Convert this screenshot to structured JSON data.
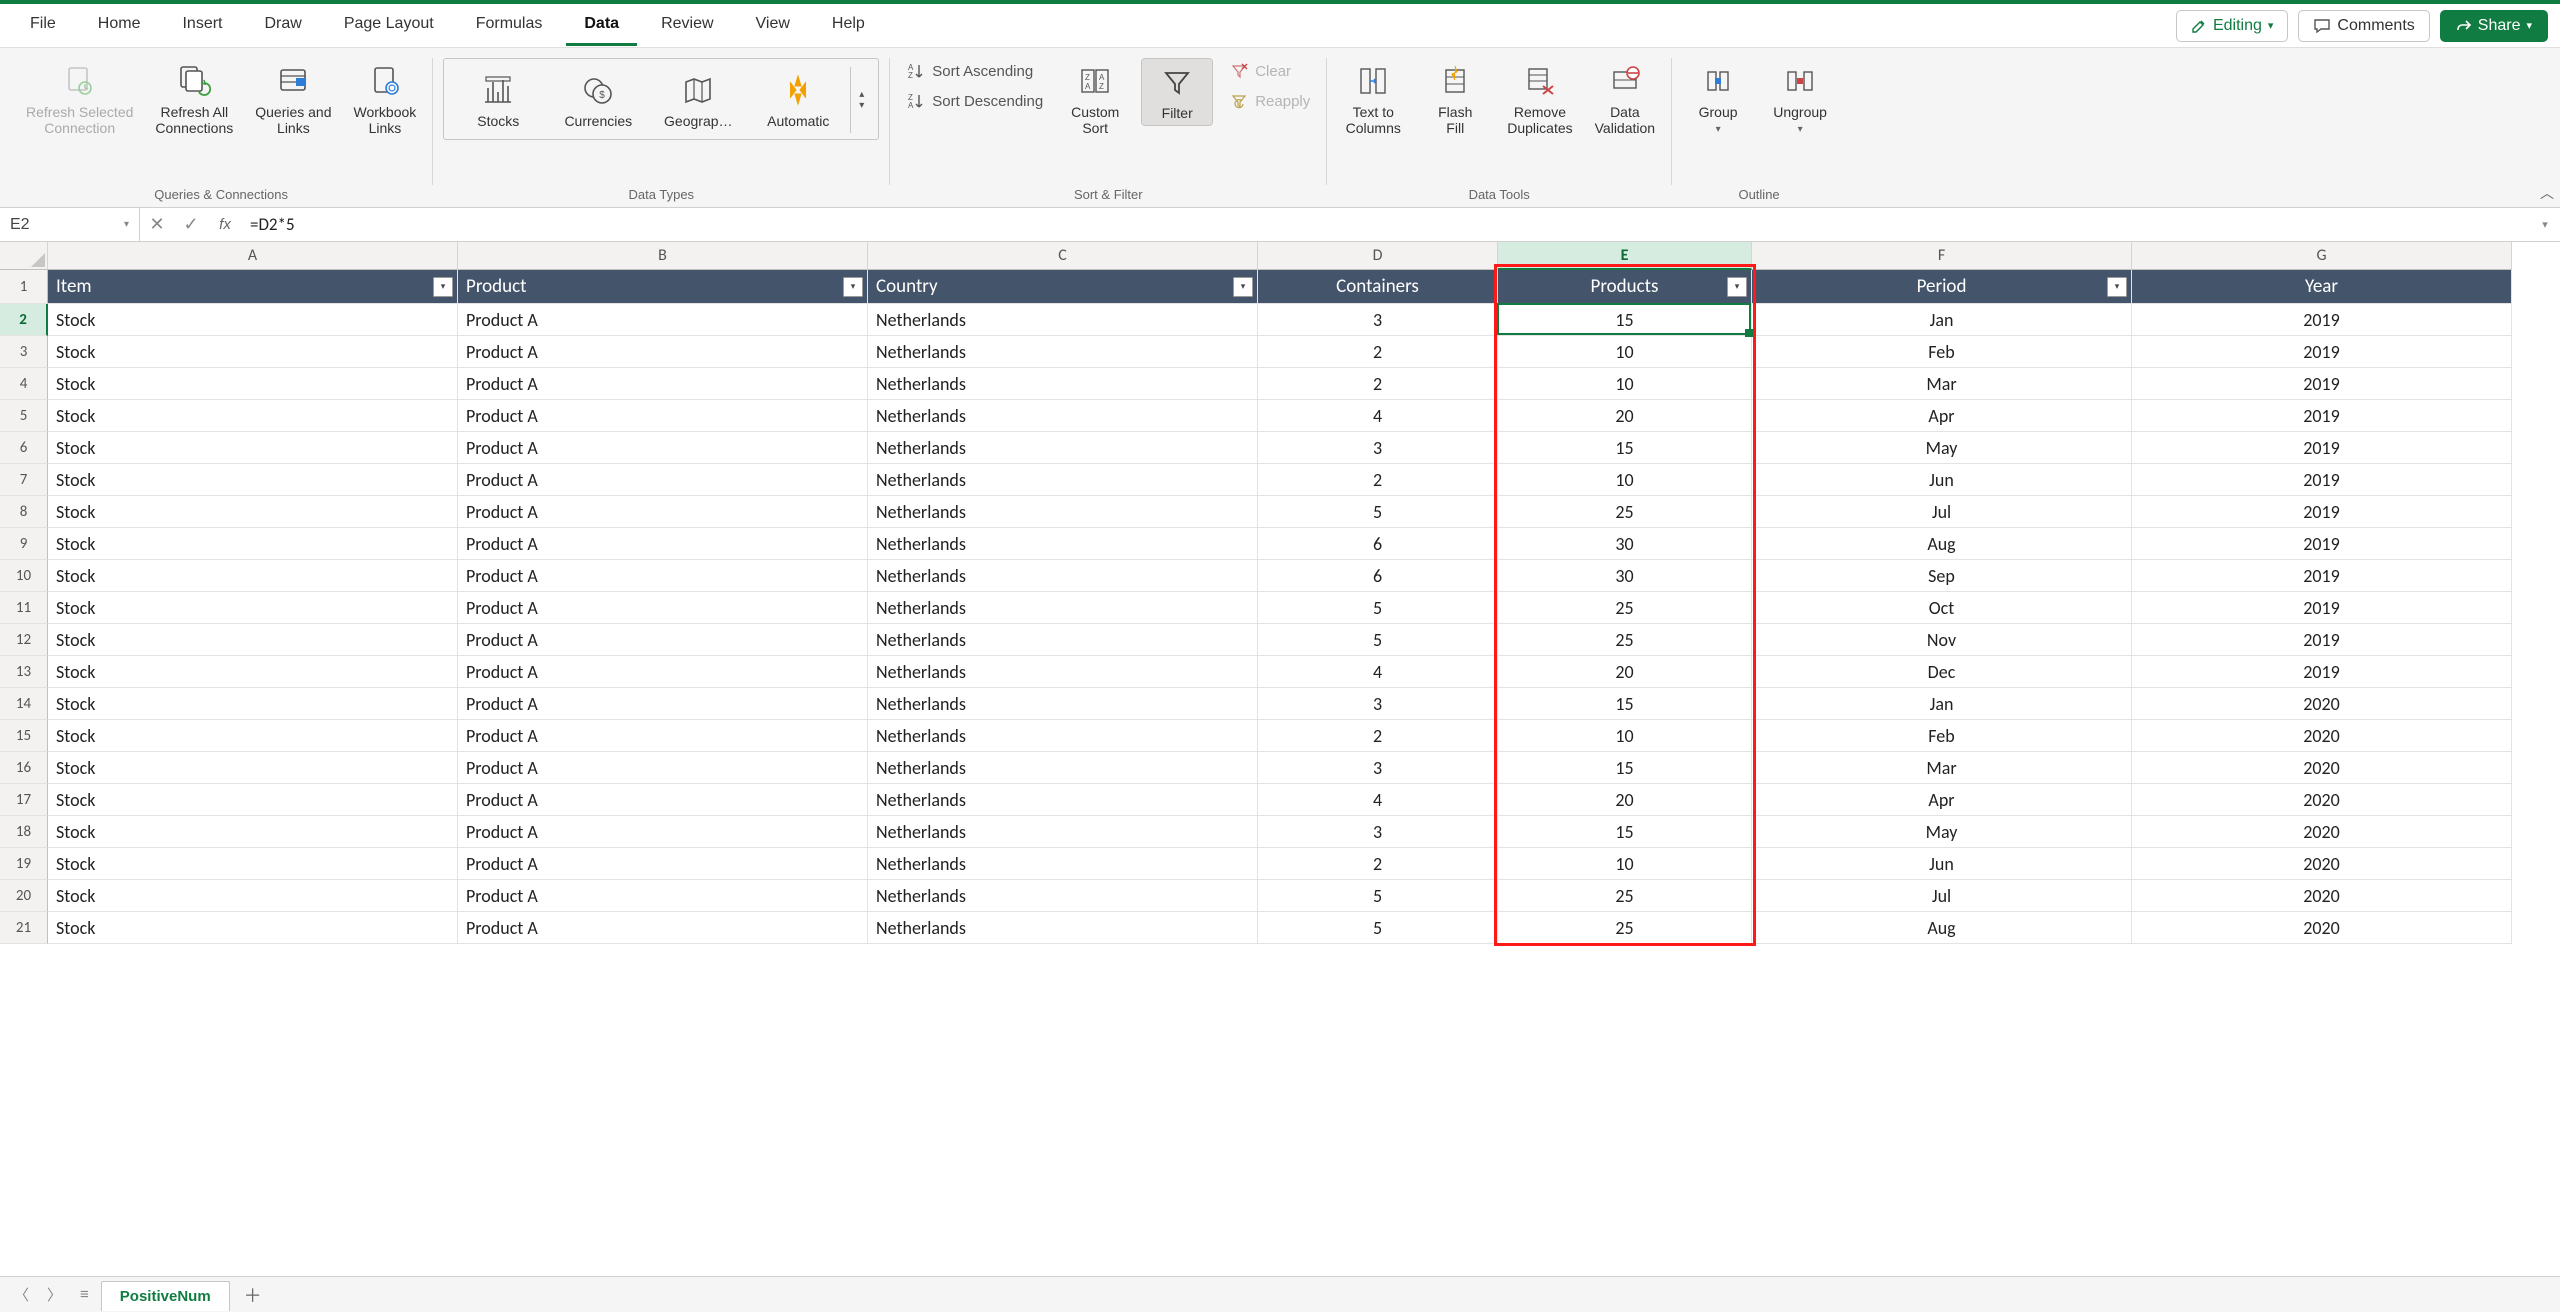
{
  "tabs": [
    "File",
    "Home",
    "Insert",
    "Draw",
    "Page Layout",
    "Formulas",
    "Data",
    "Review",
    "View",
    "Help"
  ],
  "active_tab": "Data",
  "editing_label": "Editing",
  "comments_label": "Comments",
  "share_label": "Share",
  "ribbon": {
    "queries": {
      "refresh_selected": "Refresh Selected\nConnection",
      "refresh_all": "Refresh All\nConnections",
      "queries_links": "Queries and\nLinks",
      "workbook_links": "Workbook\nLinks",
      "group_label": "Queries & Connections"
    },
    "datatypes": {
      "stocks": "Stocks",
      "currencies": "Currencies",
      "geography": "Geograp…",
      "automatic": "Automatic",
      "group_label": "Data Types"
    },
    "sortfilter": {
      "sort_asc": "Sort Ascending",
      "sort_desc": "Sort Descending",
      "custom_sort": "Custom\nSort",
      "filter": "Filter",
      "clear": "Clear",
      "reapply": "Reapply",
      "group_label": "Sort & Filter"
    },
    "datatools": {
      "text_to_columns": "Text to\nColumns",
      "flash_fill": "Flash\nFill",
      "remove_dupes": "Remove\nDuplicates",
      "data_validation": "Data\nValidation",
      "group_label": "Data Tools"
    },
    "outline": {
      "group": "Group",
      "ungroup": "Ungroup",
      "group_label": "Outline"
    }
  },
  "name_box": "E2",
  "formula": "=D2*5",
  "columns": [
    "A",
    "B",
    "C",
    "D",
    "E",
    "F",
    "G"
  ],
  "selected_col": "E",
  "selected_row": 2,
  "headers": {
    "A": "Item",
    "B": "Product",
    "C": "Country",
    "D": "Containers",
    "E": "Products",
    "F": "Period",
    "G": "Year"
  },
  "header_filters": [
    "A",
    "B",
    "C",
    "F"
  ],
  "header_align_center": [
    "D",
    "E",
    "F",
    "G"
  ],
  "rows": [
    {
      "n": 2,
      "A": "Stock",
      "B": "Product A",
      "C": "Netherlands",
      "D": 3,
      "E": 15,
      "F": "Jan",
      "G": 2019
    },
    {
      "n": 3,
      "A": "Stock",
      "B": "Product A",
      "C": "Netherlands",
      "D": 2,
      "E": 10,
      "F": "Feb",
      "G": 2019
    },
    {
      "n": 4,
      "A": "Stock",
      "B": "Product A",
      "C": "Netherlands",
      "D": 2,
      "E": 10,
      "F": "Mar",
      "G": 2019
    },
    {
      "n": 5,
      "A": "Stock",
      "B": "Product A",
      "C": "Netherlands",
      "D": 4,
      "E": 20,
      "F": "Apr",
      "G": 2019
    },
    {
      "n": 6,
      "A": "Stock",
      "B": "Product A",
      "C": "Netherlands",
      "D": 3,
      "E": 15,
      "F": "May",
      "G": 2019
    },
    {
      "n": 7,
      "A": "Stock",
      "B": "Product A",
      "C": "Netherlands",
      "D": 2,
      "E": 10,
      "F": "Jun",
      "G": 2019
    },
    {
      "n": 8,
      "A": "Stock",
      "B": "Product A",
      "C": "Netherlands",
      "D": 5,
      "E": 25,
      "F": "Jul",
      "G": 2019
    },
    {
      "n": 9,
      "A": "Stock",
      "B": "Product A",
      "C": "Netherlands",
      "D": 6,
      "E": 30,
      "F": "Aug",
      "G": 2019
    },
    {
      "n": 10,
      "A": "Stock",
      "B": "Product A",
      "C": "Netherlands",
      "D": 6,
      "E": 30,
      "F": "Sep",
      "G": 2019
    },
    {
      "n": 11,
      "A": "Stock",
      "B": "Product A",
      "C": "Netherlands",
      "D": 5,
      "E": 25,
      "F": "Oct",
      "G": 2019
    },
    {
      "n": 12,
      "A": "Stock",
      "B": "Product A",
      "C": "Netherlands",
      "D": 5,
      "E": 25,
      "F": "Nov",
      "G": 2019
    },
    {
      "n": 13,
      "A": "Stock",
      "B": "Product A",
      "C": "Netherlands",
      "D": 4,
      "E": 20,
      "F": "Dec",
      "G": 2019
    },
    {
      "n": 14,
      "A": "Stock",
      "B": "Product A",
      "C": "Netherlands",
      "D": 3,
      "E": 15,
      "F": "Jan",
      "G": 2020
    },
    {
      "n": 15,
      "A": "Stock",
      "B": "Product A",
      "C": "Netherlands",
      "D": 2,
      "E": 10,
      "F": "Feb",
      "G": 2020
    },
    {
      "n": 16,
      "A": "Stock",
      "B": "Product A",
      "C": "Netherlands",
      "D": 3,
      "E": 15,
      "F": "Mar",
      "G": 2020
    },
    {
      "n": 17,
      "A": "Stock",
      "B": "Product A",
      "C": "Netherlands",
      "D": 4,
      "E": 20,
      "F": "Apr",
      "G": 2020
    },
    {
      "n": 18,
      "A": "Stock",
      "B": "Product A",
      "C": "Netherlands",
      "D": 3,
      "E": 15,
      "F": "May",
      "G": 2020
    },
    {
      "n": 19,
      "A": "Stock",
      "B": "Product A",
      "C": "Netherlands",
      "D": 2,
      "E": 10,
      "F": "Jun",
      "G": 2020
    },
    {
      "n": 20,
      "A": "Stock",
      "B": "Product A",
      "C": "Netherlands",
      "D": 5,
      "E": 25,
      "F": "Jul",
      "G": 2020
    },
    {
      "n": 21,
      "A": "Stock",
      "B": "Product A",
      "C": "Netherlands",
      "D": 5,
      "E": 25,
      "F": "Aug",
      "G": 2020
    }
  ],
  "col_widths": {
    "RH": 48,
    "A": 410,
    "B": 410,
    "C": 390,
    "D": 240,
    "E": 254,
    "F": 380,
    "G": 380
  },
  "sheet_name": "PositiveNum",
  "chart_data": null
}
